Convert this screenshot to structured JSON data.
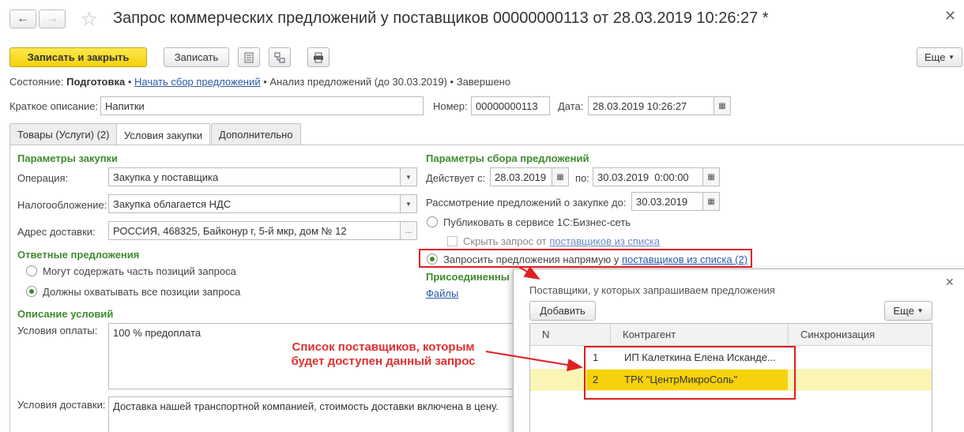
{
  "window": {
    "title": "Запрос коммерческих предложений у поставщиков 00000000113 от 28.03.2019 10:26:27 *"
  },
  "toolbar": {
    "save_close": "Записать и закрыть",
    "save": "Записать",
    "more": "Еще"
  },
  "status": {
    "label": "Состояние:",
    "current": "Подготовка",
    "start_link": "Начать сбор предложений",
    "analysis": "Анализ предложений (до 30.03.2019)",
    "done": "Завершено"
  },
  "header": {
    "short_desc_label": "Краткое описание:",
    "short_desc_value": "Напитки",
    "number_label": "Номер:",
    "number_value": "00000000113",
    "date_label": "Дата:",
    "date_value": "28.03.2019 10:26:27"
  },
  "tabs": [
    {
      "label": "Товары (Услуги) (2)"
    },
    {
      "label": "Условия закупки"
    },
    {
      "label": "Дополнительно"
    }
  ],
  "purchase": {
    "heading": "Параметры закупки",
    "operation_label": "Операция:",
    "operation_value": "Закупка у поставщика",
    "tax_label": "Налогообложение:",
    "tax_value": "Закупка облагается НДС",
    "address_label": "Адрес доставки:",
    "address_value": "РОССИЯ, 468325, Байконур г, 5-й мкр, дом № 12"
  },
  "responses": {
    "heading": "Ответные предложения",
    "opt_partial": "Могут содержать часть позиций запроса",
    "opt_all": "Должны охватывать все позиции запроса"
  },
  "conditions": {
    "heading": "Описание условий",
    "payment_label": "Условия оплаты:",
    "payment_value": "100 % предоплата",
    "delivery_label": "Условия доставки:",
    "delivery_value": "Доставка нашей транспортной компанией, стоимость доставки включена в цену."
  },
  "collection": {
    "heading": "Параметры сбора предложений",
    "valid_from_label": "Действует с:",
    "valid_from": "28.03.2019",
    "valid_to_label": "по:",
    "valid_to": "30.03.2019  0:00:00",
    "review_label": "Рассмотрение предложений о закупке до:",
    "review_date": "30.03.2019",
    "publish_option": "Публиковать в сервисе 1С:Бизнес-сеть",
    "hide_text": "Скрыть запрос от",
    "hide_link": "поставщиков из списка",
    "direct_text": "Запросить предложения напрямую у",
    "direct_link": "поставщиков из списка (2)"
  },
  "attached": {
    "heading": "Присоединенны",
    "files_link": "Файлы"
  },
  "popup": {
    "title": "Поставщики, у которых запрашиваем предложения",
    "add_button": "Добавить",
    "more": "Еще",
    "columns": [
      "N",
      "Контрагент",
      "Синхронизация"
    ],
    "rows": [
      {
        "n": "1",
        "name": "ИП Калеткина Елена Исканде..."
      },
      {
        "n": "2",
        "name": "ТРК \"ЦентрМикроСоль\""
      }
    ]
  },
  "annotation": {
    "line1": "Список поставщиков, которым",
    "line2": "будет доступен данный запрос"
  },
  "colors": {
    "accent_green": "#3e8b2f",
    "primary_yellow": "#f5d20c",
    "annotation_red": "#e02020",
    "link_blue": "#2a5aa8"
  }
}
